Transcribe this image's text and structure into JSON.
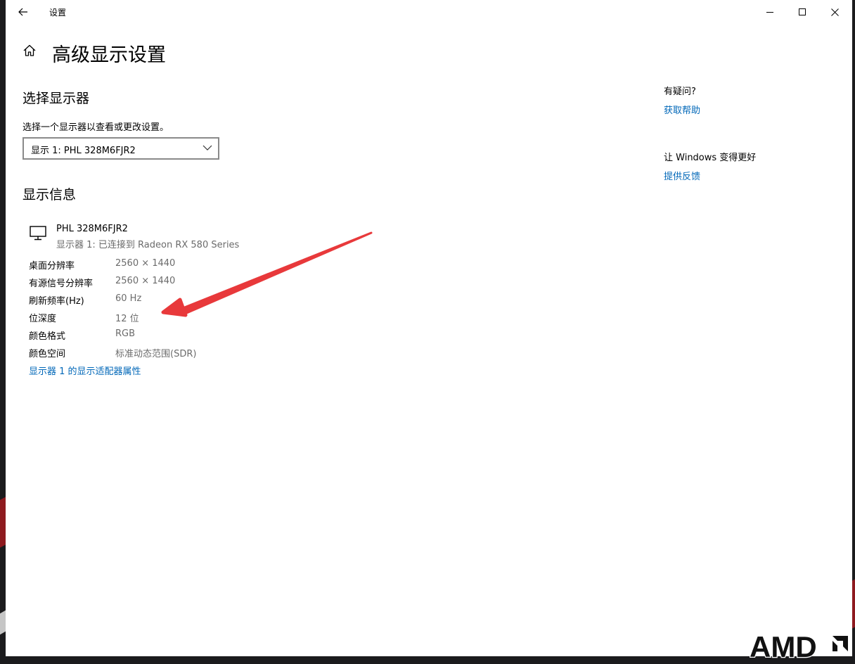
{
  "window": {
    "app_title": "设置",
    "page_title": "高级显示设置"
  },
  "select_display": {
    "heading": "选择显示器",
    "description": "选择一个显示器以查看或更改设置。",
    "dropdown_value": "显示 1: PHL 328M6FJR2"
  },
  "display_info": {
    "heading": "显示信息",
    "monitor_name": "PHL 328M6FJR2",
    "monitor_connection": "显示器 1: 已连接到 Radeon RX 580 Series",
    "rows": [
      {
        "label": "桌面分辨率",
        "value": "2560 × 1440"
      },
      {
        "label": "有源信号分辨率",
        "value": "2560 × 1440"
      },
      {
        "label": "刷新频率(Hz)",
        "value": "60 Hz"
      },
      {
        "label": "位深度",
        "value": "12 位"
      },
      {
        "label": "颜色格式",
        "value": "RGB"
      },
      {
        "label": "颜色空间",
        "value": "标准动态范围(SDR)"
      }
    ],
    "adapter_link": "显示器 1 的显示适配器属性"
  },
  "sidebar": {
    "help_heading": "有疑问?",
    "help_link": "获取帮助",
    "feedback_heading": "让 Windows 变得更好",
    "feedback_link": "提供反馈"
  },
  "colors": {
    "link": "#0067b8",
    "annotation_arrow": "#e8393b",
    "secondary_text": "#6b6b6b"
  },
  "watermark": "AMD"
}
